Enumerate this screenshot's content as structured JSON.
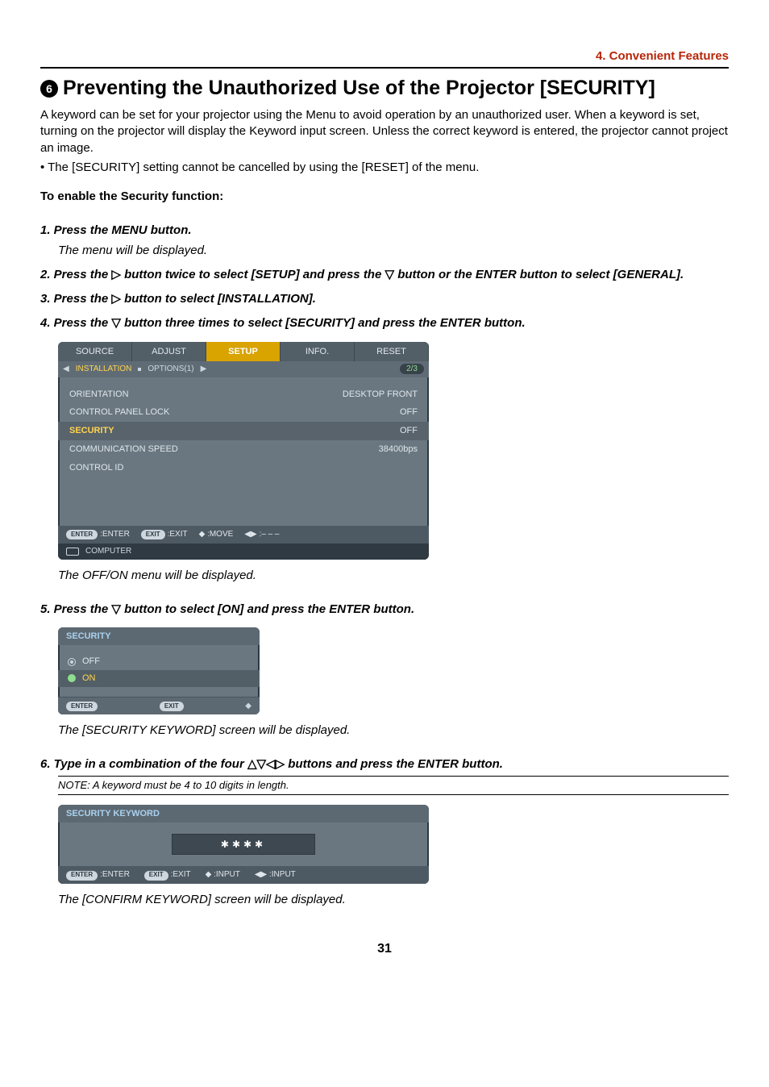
{
  "header": {
    "section": "4. Convenient Features"
  },
  "title": {
    "num": "6",
    "text": "Preventing the Unauthorized Use of the Projector [SECURITY]"
  },
  "intro": {
    "p1": "A keyword can be set for your projector using the Menu to avoid operation by an unauthorized user. When a keyword is set, turning on the projector will display the Keyword input screen. Unless the correct keyword is entered, the projector cannot project an image.",
    "p2": "• The [SECURITY] setting cannot be cancelled by using the [RESET] of the menu."
  },
  "enable_heading": "To enable the Security function:",
  "steps": {
    "s1": "1.  Press the MENU button.",
    "s1_sub": "The menu will be displayed.",
    "s2a": "2.  Press the ",
    "s2b": " button twice to select [SETUP] and press the ",
    "s2c": " button or the ENTER button to select [GENERAL].",
    "s3a": "3.  Press the ",
    "s3b": " button to select [INSTALLATION].",
    "s4a": "4.  Press the ",
    "s4b": " button three times to select [SECURITY] and press the ENTER button.",
    "s4_after": "The OFF/ON menu will be displayed.",
    "s5a": "5.  Press the ",
    "s5b": " button to select [ON] and press the ENTER button.",
    "s5_after": "The [SECURITY KEYWORD] screen will be displayed.",
    "s6a": "6.  Type in a combination of the four ",
    "s6b": " buttons and press the ENTER button.",
    "s6_note": "NOTE: A keyword must be 4 to 10 digits in length.",
    "s6_after": "The [CONFIRM KEYWORD] screen will be displayed."
  },
  "glyphs": {
    "right": "▷",
    "down": "▽",
    "all4": "△▽◁▷",
    "updown": "◆"
  },
  "shot1": {
    "tabs": [
      "SOURCE",
      "ADJUST",
      "SETUP",
      "INFO.",
      "RESET"
    ],
    "active_tab_index": 2,
    "subtab_left_arrow": "◀",
    "subtab_sel": "INSTALLATION",
    "subtab_mid": "OPTIONS(1)",
    "subtab_right_arrow": "▶",
    "page": "2/3",
    "rows": [
      {
        "label": "ORIENTATION",
        "value": "DESKTOP FRONT"
      },
      {
        "label": "CONTROL PANEL LOCK",
        "value": "OFF"
      },
      {
        "label": "SECURITY",
        "value": "OFF",
        "hl": true
      },
      {
        "label": "COMMUNICATION SPEED",
        "value": "38400bps"
      },
      {
        "label": "CONTROL ID",
        "value": ""
      }
    ],
    "footer": {
      "enter_pill": "ENTER",
      "enter": ":ENTER",
      "exit_pill": "EXIT",
      "exit": ":EXIT",
      "move": "◆ :MOVE",
      "lr": "◀▶ :– – –"
    },
    "footer2": "COMPUTER"
  },
  "shot2": {
    "title": "SECURITY",
    "off": "OFF",
    "on": "ON",
    "enter_pill": "ENTER",
    "exit_pill": "EXIT"
  },
  "shot3": {
    "title": "SECURITY KEYWORD",
    "kw": "✱✱✱✱",
    "footer": {
      "enter_pill": "ENTER",
      "enter": ":ENTER",
      "exit_pill": "EXIT",
      "exit": ":EXIT",
      "ud": "◆ :INPUT",
      "lr": "◀▶ :INPUT"
    }
  },
  "page_number": "31"
}
